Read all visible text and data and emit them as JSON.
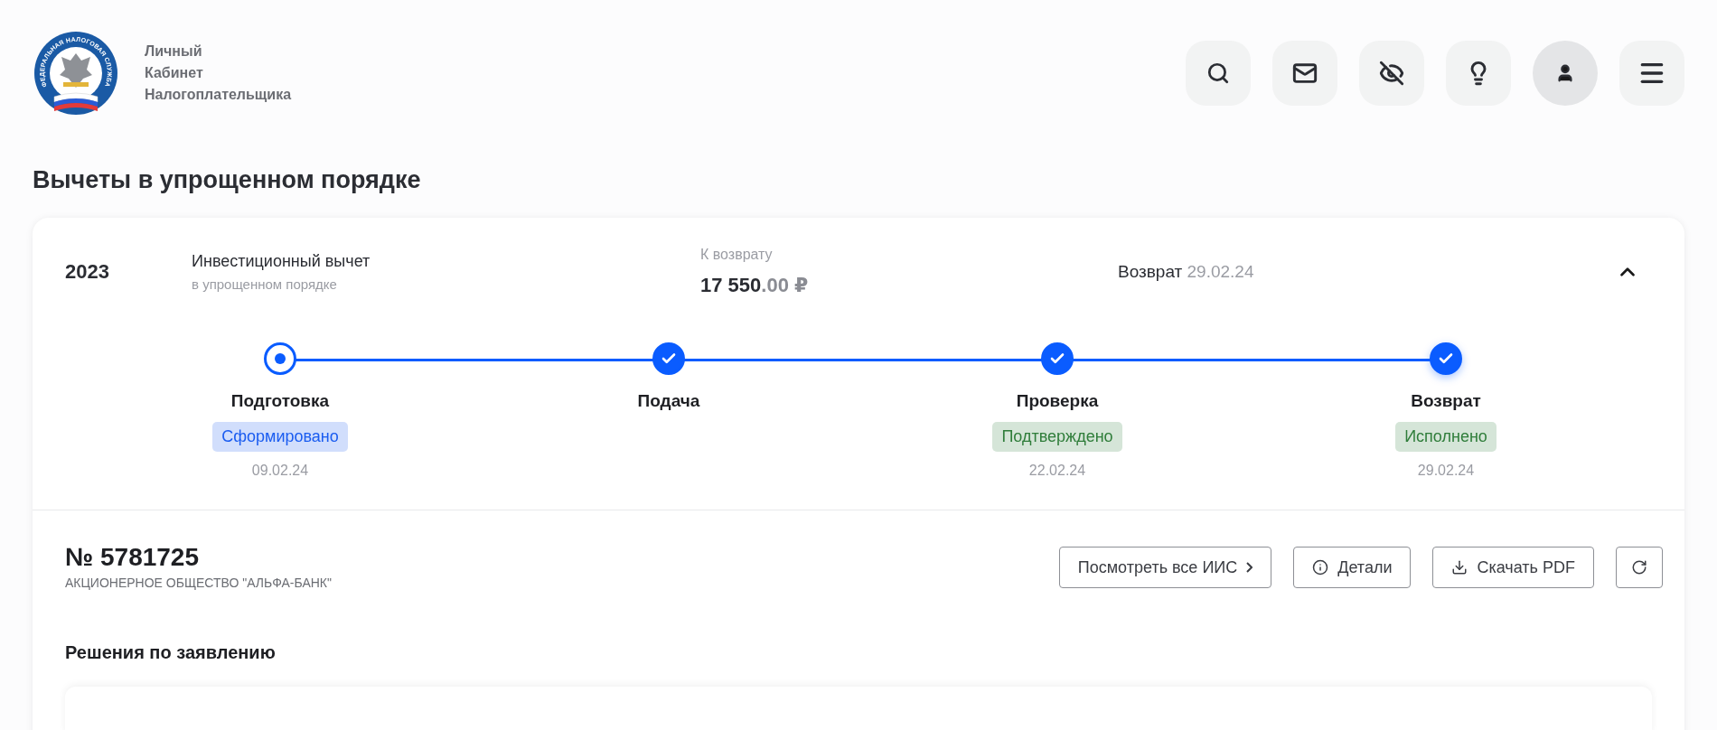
{
  "header": {
    "logo_text": "ФЕДЕРАЛЬНАЯ НАЛОГОВАЯ СЛУЖБА",
    "title_lines": [
      "Личный",
      "Кабинет",
      "Налогоплательщика"
    ],
    "actions": [
      {
        "kind": "search"
      },
      {
        "kind": "mail"
      },
      {
        "kind": "hide"
      },
      {
        "kind": "tip"
      },
      {
        "kind": "profile"
      },
      {
        "kind": "menu"
      }
    ]
  },
  "page_title": "Вычеты в упрощенном порядке",
  "card": {
    "expanded": true,
    "year": "2023",
    "deduction_type": "Инвестиционный вычет",
    "deduction_subtitle": "в упрощенном порядке",
    "refund_label": "К возврату",
    "amount_main": "17 550",
    "amount_fraction": ".00 ₽",
    "refund_status": "Возврат",
    "refund_date": "29.02.24",
    "steps": [
      {
        "label": "Подготовка",
        "done": false,
        "badge": {
          "text": "Сформировано",
          "color": "#1a5cf0"
        },
        "date": "09.02.24"
      },
      {
        "label": "Подача",
        "done": true
      },
      {
        "label": "Проверка",
        "done": true,
        "badge": {
          "text": "Подтверждено",
          "color": "#2f7d3a"
        },
        "date": "22.02.24"
      },
      {
        "label": "Возврат",
        "done": true,
        "badge": {
          "text": "Исполнено",
          "color": "#2f7d3a"
        },
        "date": "29.02.24"
      }
    ],
    "application": {
      "number": "№ 5781725",
      "bank": "АКЦИОНЕРНОЕ ОБЩЕСТВО \"АЛЬФА-БАНК\"",
      "buttons": [
        {
          "kind": "iis",
          "label": "Посмотреть все ИИС"
        },
        {
          "kind": "details",
          "label": "Детали"
        },
        {
          "kind": "pdf",
          "label": "Скачать PDF"
        },
        {
          "kind": "refresh"
        }
      ]
    },
    "decisions_title": "Решения по заявлению"
  }
}
